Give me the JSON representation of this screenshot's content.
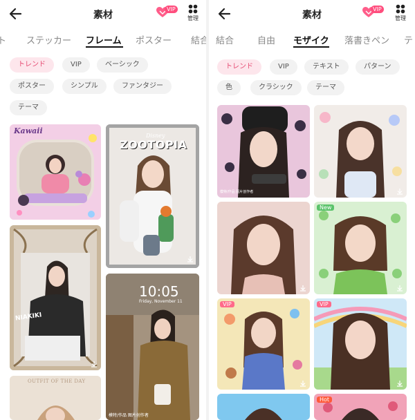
{
  "left": {
    "header": {
      "title": "素材",
      "vip_badge": "VIP",
      "manage_label": "管理"
    },
    "tabs": [
      {
        "label": "ト",
        "active": false
      },
      {
        "label": "ステッカー",
        "active": false
      },
      {
        "label": "フレーム",
        "active": true
      },
      {
        "label": "ポスター",
        "active": false
      },
      {
        "label": "結合",
        "active": false
      }
    ],
    "chips": [
      {
        "label": "トレンド",
        "active": true
      },
      {
        "label": "VIP",
        "active": false
      },
      {
        "label": "ベーシック",
        "active": false
      },
      {
        "label": "ポスター",
        "active": false
      },
      {
        "label": "シンプル",
        "active": false
      },
      {
        "label": "ファンタジー",
        "active": false
      },
      {
        "label": "テーマ",
        "active": false
      }
    ],
    "cards": {
      "kawaii_title": "Kawaii",
      "zootopia_title": "ZOOTOPIA",
      "disney_label": "Disney",
      "baroque_caption": "NIAKIKI",
      "phone_time": "10:05",
      "phone_date": "Friday, November 11",
      "outfit_title": "OUTFIT OF THE DAY",
      "credit_text": "模特/作品 图片创作者"
    }
  },
  "right": {
    "header": {
      "title": "素材",
      "vip_badge": "VIP",
      "manage_label": "管理"
    },
    "tabs": [
      {
        "label": "結合",
        "active": false
      },
      {
        "label": "自由",
        "active": false
      },
      {
        "label": "モザイク",
        "active": true
      },
      {
        "label": "落書きペン",
        "active": false
      },
      {
        "label": "テ",
        "active": false
      }
    ],
    "chips": [
      {
        "label": "トレンド",
        "active": true
      },
      {
        "label": "VIP",
        "active": false
      },
      {
        "label": "テキスト",
        "active": false
      },
      {
        "label": "パターン",
        "active": false
      },
      {
        "label": "色",
        "active": false
      },
      {
        "label": "クラシック",
        "active": false
      },
      {
        "label": "テーマ",
        "active": false
      }
    ],
    "cards": {
      "badge_new": "New",
      "badge_vip": "VIP",
      "badge_hot": "Hot",
      "credit_text": "模特/作品 图片创作者"
    }
  },
  "colors": {
    "accent_pink": "#e64d74",
    "chip_active_bg": "#fde6ec",
    "chip_bg": "#f2f2f2",
    "vip_pink": "#ff4d7d",
    "new_green": "#5bc36b"
  },
  "icons": [
    "back-arrow-icon",
    "vip-heart-icon",
    "manage-grid-icon",
    "download-icon"
  ]
}
